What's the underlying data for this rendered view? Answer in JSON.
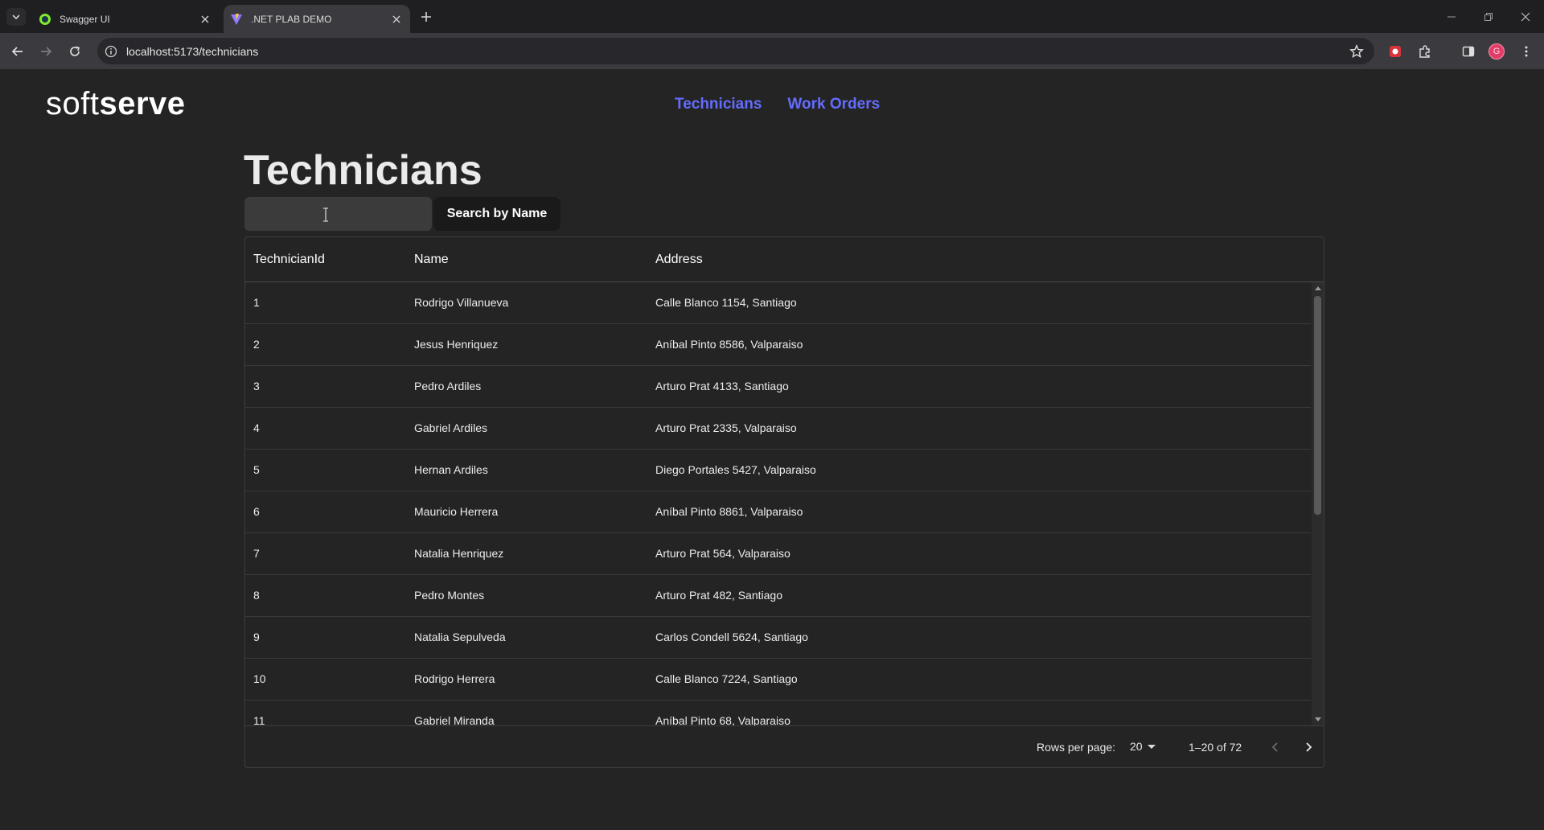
{
  "browser": {
    "tabs": [
      {
        "title": "Swagger UI",
        "active": false,
        "icon": "swagger-favicon"
      },
      {
        "title": ".NET PLAB DEMO",
        "active": true,
        "icon": "vite-favicon"
      }
    ],
    "url": "localhost:5173/technicians"
  },
  "header": {
    "logo_light": "soft",
    "logo_bold": "serve",
    "nav": [
      {
        "label": "Technicians"
      },
      {
        "label": "Work Orders"
      }
    ],
    "nav_color": "#646cff"
  },
  "main": {
    "title": "Technicians",
    "search": {
      "value": "",
      "placeholder": ""
    },
    "search_button": "Search by Name"
  },
  "table": {
    "columns": [
      "TechnicianId",
      "Name",
      "Address"
    ],
    "rows": [
      {
        "id": "1",
        "name": "Rodrigo Villanueva",
        "address": "Calle Blanco 1154, Santiago"
      },
      {
        "id": "2",
        "name": "Jesus Henriquez",
        "address": "Aníbal Pinto 8586, Valparaiso"
      },
      {
        "id": "3",
        "name": "Pedro Ardiles",
        "address": "Arturo Prat 4133, Santiago"
      },
      {
        "id": "4",
        "name": "Gabriel Ardiles",
        "address": "Arturo Prat 2335, Valparaiso"
      },
      {
        "id": "5",
        "name": "Hernan Ardiles",
        "address": "Diego Portales 5427, Valparaiso"
      },
      {
        "id": "6",
        "name": "Mauricio Herrera",
        "address": "Aníbal Pinto 8861, Valparaiso"
      },
      {
        "id": "7",
        "name": "Natalia Henriquez",
        "address": "Arturo Prat 564, Valparaiso"
      },
      {
        "id": "8",
        "name": "Pedro Montes",
        "address": "Arturo Prat 482, Santiago"
      },
      {
        "id": "9",
        "name": "Natalia Sepulveda",
        "address": "Carlos Condell 5624, Santiago"
      },
      {
        "id": "10",
        "name": "Rodrigo Herrera",
        "address": "Calle Blanco 7224, Santiago"
      },
      {
        "id": "11",
        "name": "Gabriel Miranda",
        "address": "Aníbal Pinto 68, Valparaiso"
      }
    ],
    "footer": {
      "rows_per_page_label": "Rows per page:",
      "rows_per_page_value": "20",
      "range": "1–20 of 72"
    }
  }
}
